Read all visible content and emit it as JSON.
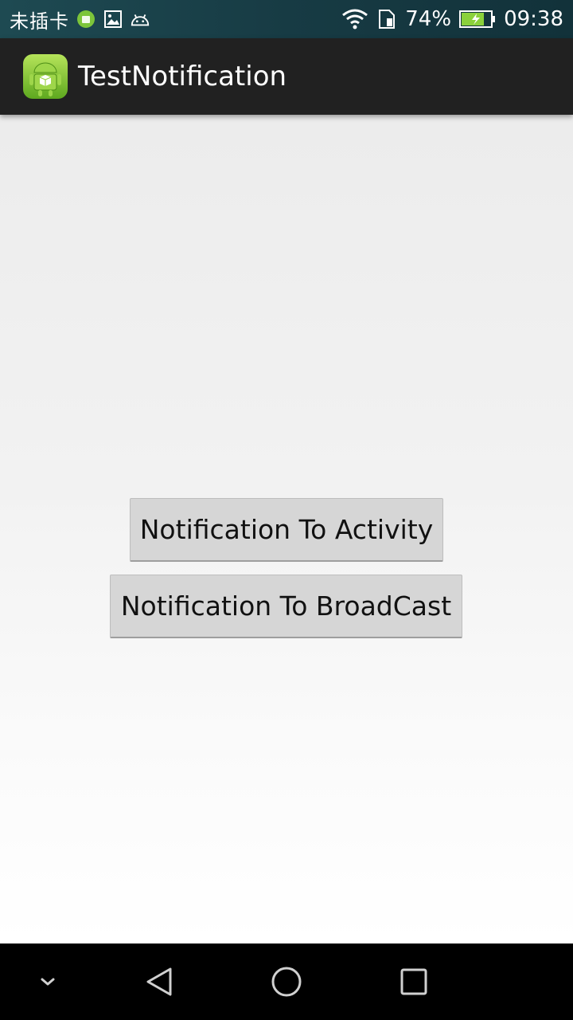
{
  "status_bar": {
    "carrier": "未插卡",
    "battery_percent": "74%",
    "time": "09:38",
    "icons": [
      "app-notification-icon",
      "image-icon",
      "android-icon",
      "wifi-icon",
      "sim-icon",
      "battery-charging-icon"
    ]
  },
  "action_bar": {
    "title": "TestNotification",
    "icon": "android-app-icon"
  },
  "main": {
    "buttons": [
      {
        "label": "Notification To Activity"
      },
      {
        "label": "Notification To BroadCast"
      }
    ]
  },
  "nav_bar": {
    "icons": [
      "chevron-down-icon",
      "back-icon",
      "home-icon",
      "recents-icon"
    ]
  },
  "colors": {
    "status_bar": "#173b44",
    "action_bar": "#212121",
    "button_bg": "#d6d6d6",
    "nav_bar": "#000000"
  }
}
